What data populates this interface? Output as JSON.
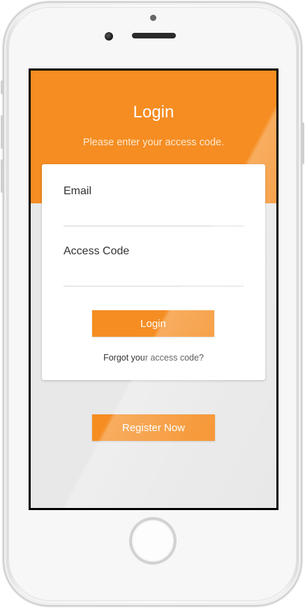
{
  "header": {
    "title": "Login",
    "subtitle": "Please enter your access code."
  },
  "form": {
    "email": {
      "label": "Email",
      "value": "",
      "placeholder": ""
    },
    "access_code": {
      "label": "Access Code",
      "value": "",
      "placeholder": ""
    },
    "login_label": "Login",
    "forgot_label": "Forgot your access code?"
  },
  "register_label": "Register Now",
  "colors": {
    "accent": "#f58d22",
    "background": "#e8e8e8",
    "card": "#ffffff"
  }
}
